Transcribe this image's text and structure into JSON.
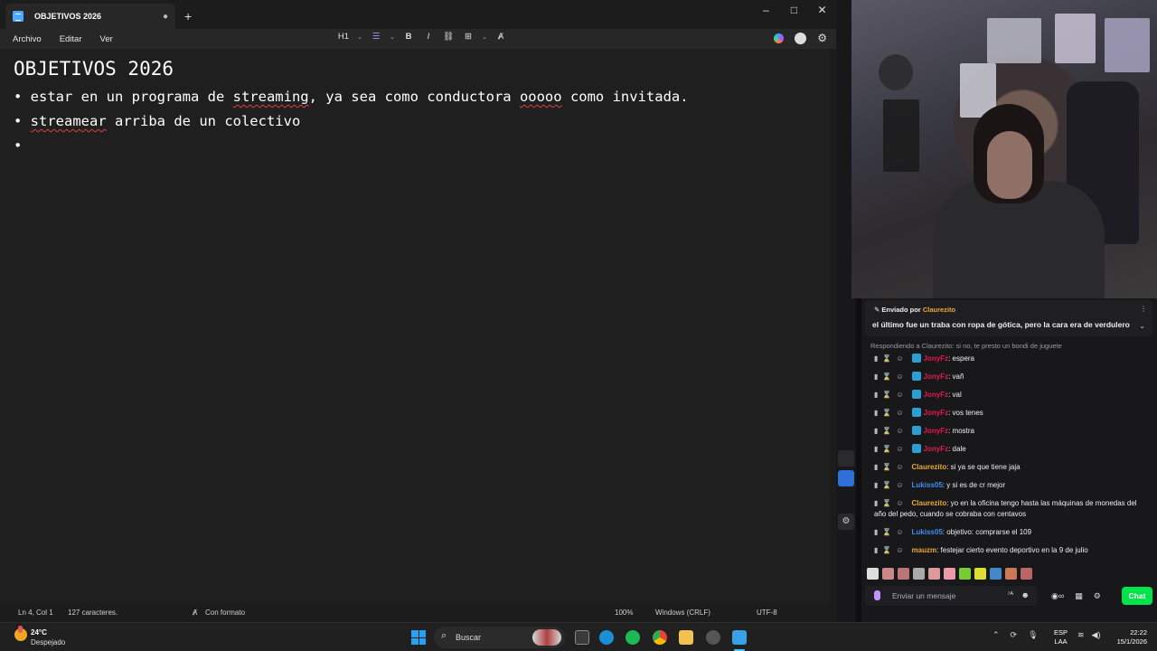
{
  "notepad": {
    "tab_title": "OBJETIVOS 2026",
    "new_tab": "+",
    "menu": [
      "Archivo",
      "Editar",
      "Ver"
    ],
    "toolbar": {
      "heading": "H1",
      "bold": "B",
      "italic": "I"
    },
    "content": {
      "title": "OBJETIVOS 2026",
      "bullets": [
        [
          "estar en un programa de ",
          {
            "t": "streaming",
            "err": true
          },
          ", ya sea como conductora ",
          {
            "t": "ooooo",
            "err": true
          },
          " como invitada."
        ],
        [
          {
            "t": "streamear",
            "err": true
          },
          " arriba de un colectivo"
        ],
        [
          ""
        ]
      ]
    },
    "status": {
      "position": "Ln 4, Col 1",
      "chars": "127 caracteres.",
      "format": "Con formato",
      "zoom": "100%",
      "line_ending": "Windows (CRLF)",
      "encoding": "UTF-8"
    }
  },
  "chat": {
    "pinned": {
      "prefix": "Enviado por",
      "author": "Claurezito",
      "message": "el último fue un traba con ropa de gótica, pero la cara era de verdulero"
    },
    "reply_context": "Respondiendo a Claurezito: si no, te presto un bondi de juguete",
    "messages": [
      {
        "user": "JonyFz",
        "color": "#e8184d",
        "text": ": espera",
        "badge": true
      },
      {
        "user": "JonyFz",
        "color": "#e8184d",
        "text": ": vañ",
        "badge": true
      },
      {
        "user": "JonyFz",
        "color": "#e8184d",
        "text": ": val",
        "badge": true
      },
      {
        "user": "JonyFz",
        "color": "#e8184d",
        "text": ": vos tenes",
        "badge": true
      },
      {
        "user": "JonyFz",
        "color": "#e8184d",
        "text": ": mostra",
        "badge": true
      },
      {
        "user": "JonyFz",
        "color": "#e8184d",
        "text": ": dale",
        "badge": true
      },
      {
        "user": "Claurezito",
        "color": "#f0a830",
        "text": ": si ya se que tiene jaja",
        "badge": false
      },
      {
        "user": "Lukiss05",
        "color": "#3d8ef0",
        "text": ": y si es de cr mejor",
        "badge": false
      },
      {
        "user": "Claurezito",
        "color": "#f0a830",
        "text": ": yo en la oficina tengo hasta las máquinas de monedas del año del pedo, cuando se cobraba con centavos",
        "badge": false
      },
      {
        "user": "Lukiss05",
        "color": "#3d8ef0",
        "text": ": objetivo: comprarse el 109",
        "badge": false
      },
      {
        "user": "mauzm",
        "color": "#f0a830",
        "text": ": festejar cierto evento deportivo en la 9 de julio",
        "badge": false
      }
    ],
    "input_placeholder": "Enviar un mensaje",
    "chat_button": "Chat"
  },
  "taskbar": {
    "temperature": "24°C",
    "weather": "Despejado",
    "search_label": "Buscar",
    "lang_top": "ESP",
    "lang_bottom": "LAA",
    "time": "22:22",
    "date": "15/1/2026"
  }
}
